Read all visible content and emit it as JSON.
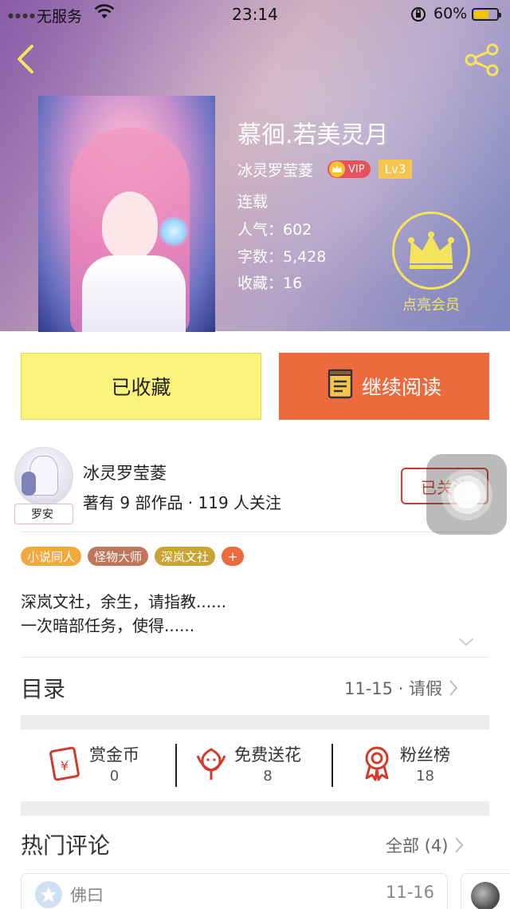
{
  "status_bar": {
    "carrier": "无服务",
    "time": "23:14",
    "battery": "60%"
  },
  "book": {
    "title": "慕徊.若美灵月",
    "author": "冰灵罗莹菱",
    "vip_label": "VIP",
    "level": "Lv3",
    "status": "连载",
    "popularity": "人气：602",
    "word_count": "字数：5,428",
    "favorites": "收藏：16"
  },
  "vip_promo": {
    "label": "点亮会员",
    "color": "#f4e45c"
  },
  "actions": {
    "favorited_label": "已收藏",
    "continue_label": "继续阅读"
  },
  "author_card": {
    "name": "冰灵罗莹菱",
    "stats": "著有 9 部作品 · 119 人关注",
    "avatar_tag": "罗安",
    "follow_label": "已关注"
  },
  "tags": [
    {
      "label": "小说同人",
      "color": "#f2a93b"
    },
    {
      "label": "怪物大师",
      "color": "#c0765a"
    },
    {
      "label": "深岚文社",
      "color": "#c8a335"
    }
  ],
  "tag_more": "+",
  "intro": {
    "line1": "深岚文社，余生，请指教......",
    "line2": "一次暗部任务，使得......"
  },
  "toc": {
    "title": "目录",
    "latest": "11-15 · 请假"
  },
  "rewards": [
    {
      "label": "赏金币",
      "value": "0",
      "icon": "red-envelope-icon"
    },
    {
      "label": "免费送花",
      "value": "8",
      "icon": "flower-icon"
    },
    {
      "label": "粉丝榜",
      "value": "18",
      "icon": "ribbon-medal-icon"
    }
  ],
  "comments": {
    "title": "热门评论",
    "all_label": "全部 (4)",
    "first_user": "佛曰",
    "first_date": "11-16"
  },
  "colors": {
    "accent_orange": "#ec6a3e",
    "favorite_yellow": "#fbf37b",
    "follow_red": "#d13b2e"
  }
}
